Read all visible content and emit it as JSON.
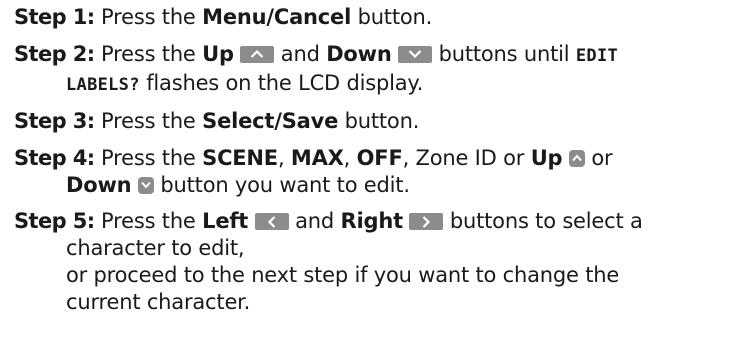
{
  "steps": [
    {
      "label": "Step 1:",
      "text_1": "Press the",
      "bold_1": "Menu/Cancel",
      "text_2": "button."
    },
    {
      "label": "Step 2:",
      "text_1": "Press the",
      "bold_1": "Up",
      "text_2": "and",
      "bold_2": "Down",
      "text_3": "buttons until",
      "code_1": "EDIT",
      "code_2": "LABELS?",
      "text_4": "flashes on the LCD display."
    },
    {
      "label": "Step 3:",
      "text_1": "Press the",
      "bold_1": "Select/Save",
      "text_2": "button."
    },
    {
      "label": "Step 4:",
      "text_1": "Press the",
      "bold_1": "SCENE",
      "sep_1": ",",
      "bold_2": "MAX",
      "sep_2": ",",
      "bold_3": "OFF",
      "text_2": ", Zone ID or",
      "bold_4": "Up",
      "text_3": "or",
      "bold_5": "Down",
      "text_4": "button you want to edit."
    },
    {
      "label": "Step 5:",
      "text_1": "Press the",
      "bold_1": "Left",
      "text_2": "and",
      "bold_2": "Right",
      "text_3": "buttons to select a",
      "line_2": "character to edit,",
      "line_3": "or proceed to the next step if you want to change the",
      "line_4": "current character."
    }
  ],
  "icons": {
    "button_fill": "#8c8c8c",
    "glyph_color": "#ffffff",
    "names": [
      "chevron-up-icon",
      "chevron-down-icon",
      "chevron-left-icon",
      "chevron-right-icon"
    ]
  }
}
